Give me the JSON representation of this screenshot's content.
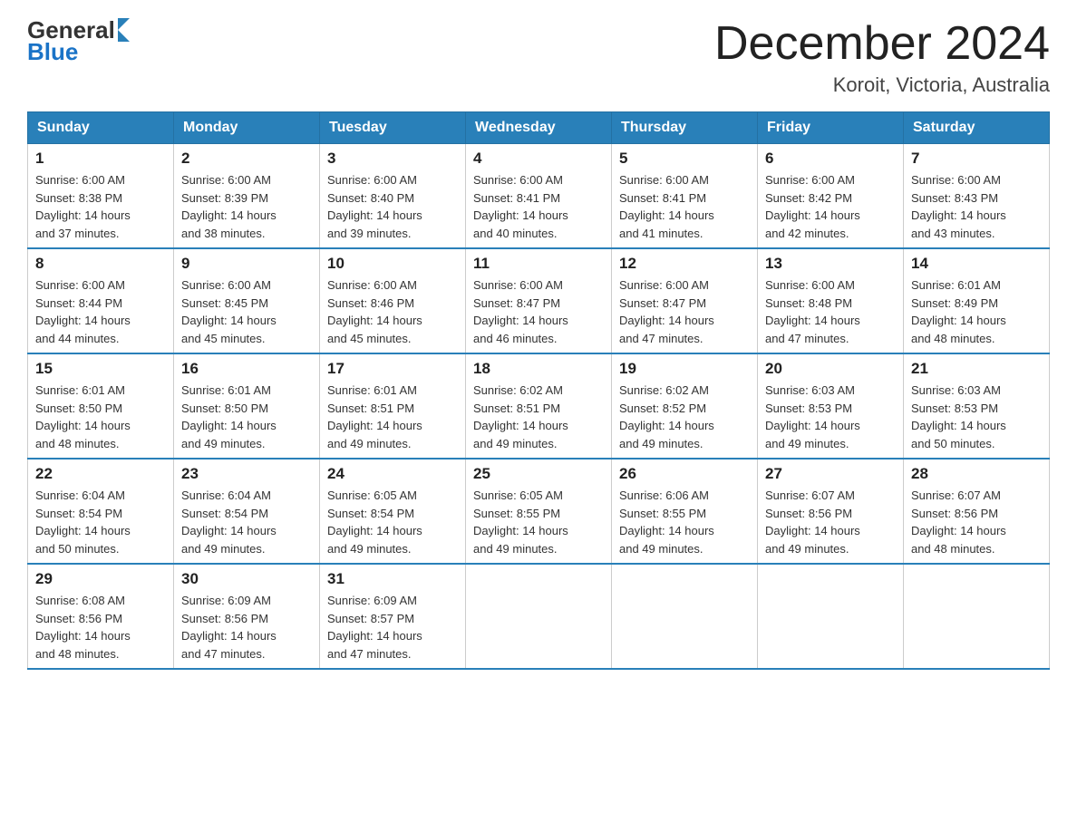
{
  "header": {
    "logo_general": "General",
    "logo_blue": "Blue",
    "title": "December 2024",
    "subtitle": "Koroit, Victoria, Australia"
  },
  "days_of_week": [
    "Sunday",
    "Monday",
    "Tuesday",
    "Wednesday",
    "Thursday",
    "Friday",
    "Saturday"
  ],
  "weeks": [
    [
      {
        "day": "1",
        "sunrise": "6:00 AM",
        "sunset": "8:38 PM",
        "daylight": "14 hours and 37 minutes."
      },
      {
        "day": "2",
        "sunrise": "6:00 AM",
        "sunset": "8:39 PM",
        "daylight": "14 hours and 38 minutes."
      },
      {
        "day": "3",
        "sunrise": "6:00 AM",
        "sunset": "8:40 PM",
        "daylight": "14 hours and 39 minutes."
      },
      {
        "day": "4",
        "sunrise": "6:00 AM",
        "sunset": "8:41 PM",
        "daylight": "14 hours and 40 minutes."
      },
      {
        "day": "5",
        "sunrise": "6:00 AM",
        "sunset": "8:41 PM",
        "daylight": "14 hours and 41 minutes."
      },
      {
        "day": "6",
        "sunrise": "6:00 AM",
        "sunset": "8:42 PM",
        "daylight": "14 hours and 42 minutes."
      },
      {
        "day": "7",
        "sunrise": "6:00 AM",
        "sunset": "8:43 PM",
        "daylight": "14 hours and 43 minutes."
      }
    ],
    [
      {
        "day": "8",
        "sunrise": "6:00 AM",
        "sunset": "8:44 PM",
        "daylight": "14 hours and 44 minutes."
      },
      {
        "day": "9",
        "sunrise": "6:00 AM",
        "sunset": "8:45 PM",
        "daylight": "14 hours and 45 minutes."
      },
      {
        "day": "10",
        "sunrise": "6:00 AM",
        "sunset": "8:46 PM",
        "daylight": "14 hours and 45 minutes."
      },
      {
        "day": "11",
        "sunrise": "6:00 AM",
        "sunset": "8:47 PM",
        "daylight": "14 hours and 46 minutes."
      },
      {
        "day": "12",
        "sunrise": "6:00 AM",
        "sunset": "8:47 PM",
        "daylight": "14 hours and 47 minutes."
      },
      {
        "day": "13",
        "sunrise": "6:00 AM",
        "sunset": "8:48 PM",
        "daylight": "14 hours and 47 minutes."
      },
      {
        "day": "14",
        "sunrise": "6:01 AM",
        "sunset": "8:49 PM",
        "daylight": "14 hours and 48 minutes."
      }
    ],
    [
      {
        "day": "15",
        "sunrise": "6:01 AM",
        "sunset": "8:50 PM",
        "daylight": "14 hours and 48 minutes."
      },
      {
        "day": "16",
        "sunrise": "6:01 AM",
        "sunset": "8:50 PM",
        "daylight": "14 hours and 49 minutes."
      },
      {
        "day": "17",
        "sunrise": "6:01 AM",
        "sunset": "8:51 PM",
        "daylight": "14 hours and 49 minutes."
      },
      {
        "day": "18",
        "sunrise": "6:02 AM",
        "sunset": "8:51 PM",
        "daylight": "14 hours and 49 minutes."
      },
      {
        "day": "19",
        "sunrise": "6:02 AM",
        "sunset": "8:52 PM",
        "daylight": "14 hours and 49 minutes."
      },
      {
        "day": "20",
        "sunrise": "6:03 AM",
        "sunset": "8:53 PM",
        "daylight": "14 hours and 49 minutes."
      },
      {
        "day": "21",
        "sunrise": "6:03 AM",
        "sunset": "8:53 PM",
        "daylight": "14 hours and 50 minutes."
      }
    ],
    [
      {
        "day": "22",
        "sunrise": "6:04 AM",
        "sunset": "8:54 PM",
        "daylight": "14 hours and 50 minutes."
      },
      {
        "day": "23",
        "sunrise": "6:04 AM",
        "sunset": "8:54 PM",
        "daylight": "14 hours and 49 minutes."
      },
      {
        "day": "24",
        "sunrise": "6:05 AM",
        "sunset": "8:54 PM",
        "daylight": "14 hours and 49 minutes."
      },
      {
        "day": "25",
        "sunrise": "6:05 AM",
        "sunset": "8:55 PM",
        "daylight": "14 hours and 49 minutes."
      },
      {
        "day": "26",
        "sunrise": "6:06 AM",
        "sunset": "8:55 PM",
        "daylight": "14 hours and 49 minutes."
      },
      {
        "day": "27",
        "sunrise": "6:07 AM",
        "sunset": "8:56 PM",
        "daylight": "14 hours and 49 minutes."
      },
      {
        "day": "28",
        "sunrise": "6:07 AM",
        "sunset": "8:56 PM",
        "daylight": "14 hours and 48 minutes."
      }
    ],
    [
      {
        "day": "29",
        "sunrise": "6:08 AM",
        "sunset": "8:56 PM",
        "daylight": "14 hours and 48 minutes."
      },
      {
        "day": "30",
        "sunrise": "6:09 AM",
        "sunset": "8:56 PM",
        "daylight": "14 hours and 47 minutes."
      },
      {
        "day": "31",
        "sunrise": "6:09 AM",
        "sunset": "8:57 PM",
        "daylight": "14 hours and 47 minutes."
      },
      null,
      null,
      null,
      null
    ]
  ],
  "labels": {
    "sunrise": "Sunrise:",
    "sunset": "Sunset:",
    "daylight": "Daylight:"
  }
}
